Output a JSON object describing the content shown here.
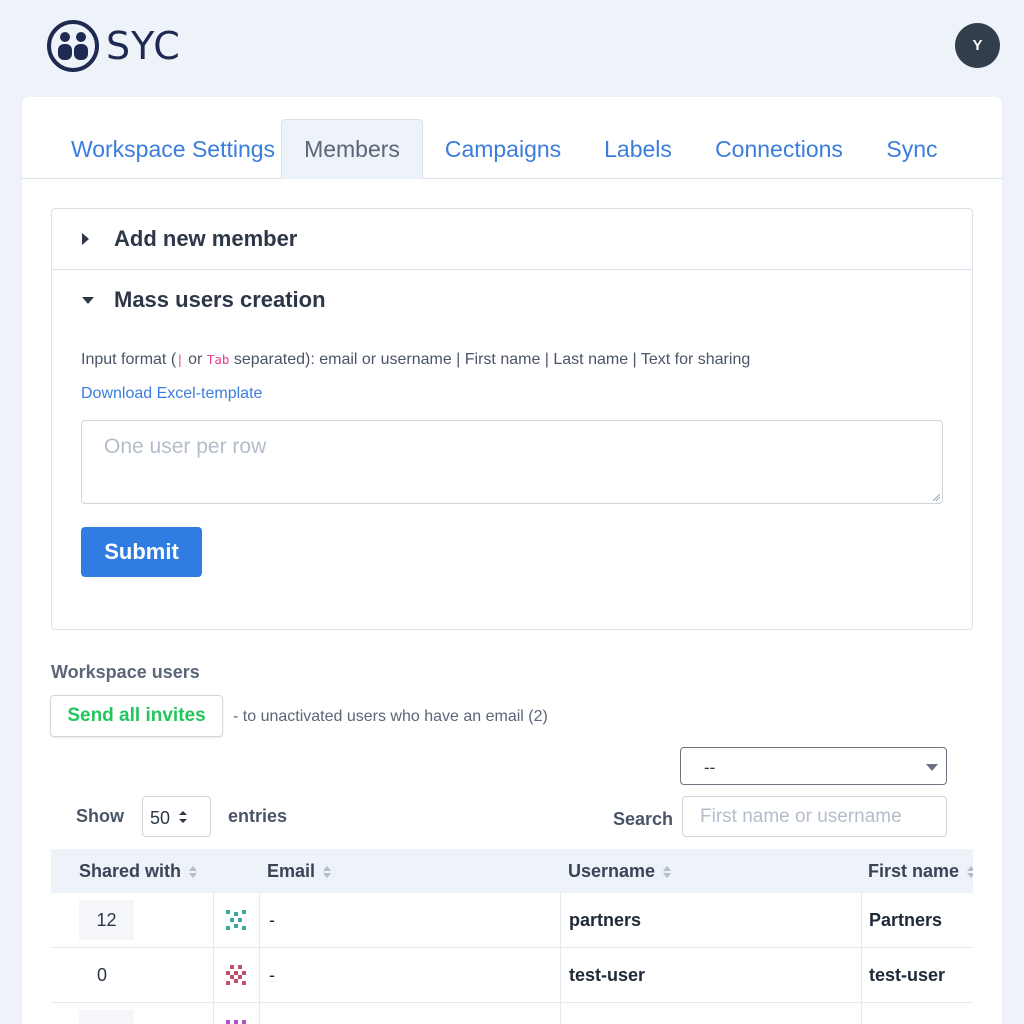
{
  "app": {
    "logo_text": "SYC",
    "user_initial": "Y"
  },
  "tabs": [
    {
      "label": "Workspace Settings",
      "active": false
    },
    {
      "label": "Members",
      "active": true
    },
    {
      "label": "Campaigns",
      "active": false
    },
    {
      "label": "Labels",
      "active": false
    },
    {
      "label": "Connections",
      "active": false
    },
    {
      "label": "Sync",
      "active": false
    }
  ],
  "add_member": {
    "title": "Add new member",
    "expanded": false
  },
  "mass_creation": {
    "title": "Mass users creation",
    "expanded": true,
    "format_prefix": "Input format (",
    "pipe_code": "|",
    "or_text": " or ",
    "tab_code": "Tab",
    "format_suffix": " separated): email or username | First name | Last name | Text for sharing",
    "download_link": "Download Excel-template",
    "textarea_placeholder": "One user per row",
    "submit_label": "Submit"
  },
  "workspace_users": {
    "title": "Workspace users",
    "send_invites_label": "Send all invites",
    "send_invites_note": "- to unactivated users who have an email (2)",
    "filter_value": "--",
    "show_label": "Show",
    "entries_value": "50",
    "entries_label": "entries",
    "search_label": "Search",
    "search_placeholder": "First name or username"
  },
  "table": {
    "columns": [
      "Shared with",
      "Email",
      "Username",
      "First name"
    ],
    "rows": [
      {
        "shared_with": "12",
        "email": "-",
        "username": "partners",
        "first_name": "Partners"
      },
      {
        "shared_with": "0",
        "email": "-",
        "username": "test-user",
        "first_name": "test-user"
      }
    ]
  },
  "colors": {
    "link": "#3b7ddd",
    "primary": "#2f7de1",
    "success": "#22c55e",
    "code": "#e83e8c",
    "avatar_bg": "#323e4b"
  }
}
